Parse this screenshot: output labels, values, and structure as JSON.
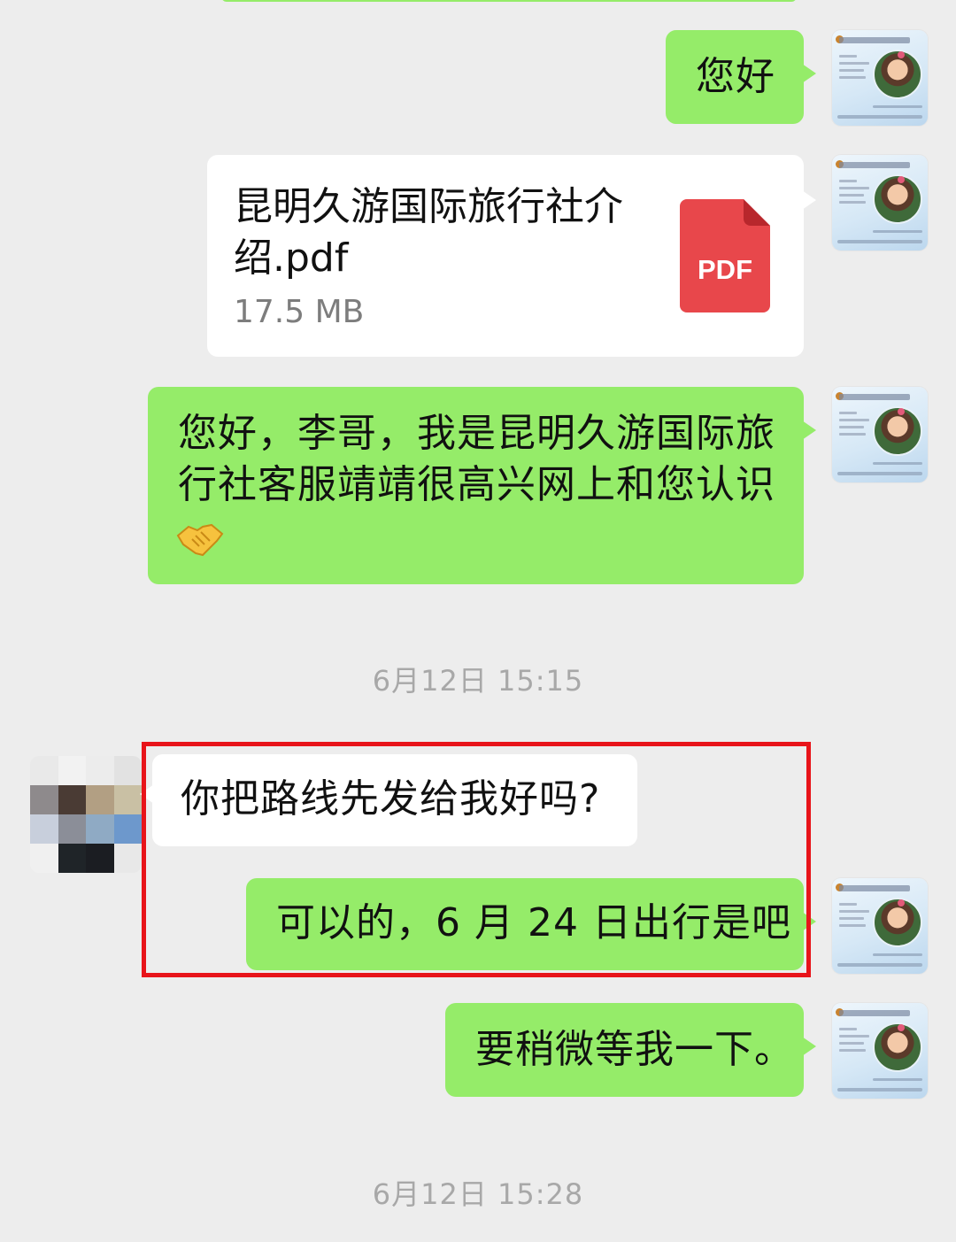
{
  "messages": [
    {
      "id": "m1",
      "sender": "me",
      "type": "text",
      "text": "您好"
    },
    {
      "id": "m2",
      "sender": "me",
      "type": "file",
      "file_name": "昆明久游国际旅行社介绍.pdf",
      "file_size": "17.5 MB",
      "file_icon_label": "PDF"
    },
    {
      "id": "m3",
      "sender": "me",
      "type": "text",
      "text": "您好，李哥，我是昆明久游国际旅行社客服靖靖很高兴网上和您认识",
      "emoji": "handshake-emoji"
    },
    {
      "id": "m4",
      "sender": "other",
      "type": "text",
      "text": "你把路线先发给我好吗?"
    },
    {
      "id": "m5",
      "sender": "me",
      "type": "text",
      "text": "可以的，6 月 24 日出行是吧"
    },
    {
      "id": "m6",
      "sender": "me",
      "type": "text",
      "text": "要稍微等我一下。"
    }
  ],
  "timestamps": {
    "t1": "6月12日 15:15",
    "t2": "6月12日 15:28"
  },
  "colors": {
    "background": "#ededed",
    "my_bubble": "#95ec69",
    "other_bubble": "#ffffff",
    "timestamp_text": "#a8a8a8",
    "highlight_border": "#e8141a",
    "pdf_icon": "#e8474b"
  },
  "icons": {
    "my_avatar": "business-card-avatar",
    "other_avatar": "pixelated-avatar",
    "file": "pdf-file-icon",
    "emoji": "handshake-emoji"
  }
}
